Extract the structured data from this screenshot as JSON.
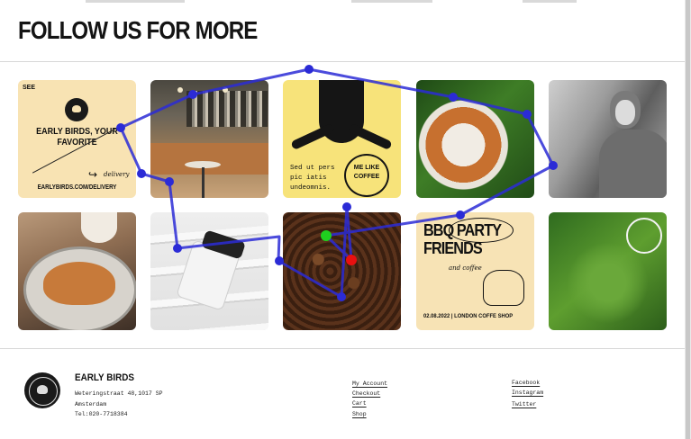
{
  "header": {
    "title": "FOLLOW US FOR MORE"
  },
  "gallery": {
    "tile1": {
      "see": "SEE",
      "headline": "EARLY BIRDS, YOUR FAVORITE",
      "delivery": "delivery",
      "url": "EARLYBIRDS.COM/DELIVERY"
    },
    "tile3": {
      "text": "Sed ut pers pic iatis undeomnis.",
      "badge": "ME LIKE COFFEE"
    },
    "tile9": {
      "headline": "BBQ PARTY FRIENDS",
      "subtitle": "and coffee",
      "date": "02.08.2022 | LONDON COFFE SHOP"
    }
  },
  "footer": {
    "brand": "EARLY BIRDS",
    "address_line1": "Weteringstraat 48,1017 SP",
    "address_line2": "Amsterdam",
    "phone": "Tel:020-7718384",
    "links_col1": [
      "My Account",
      "Checkout",
      "Cart",
      "Shop"
    ],
    "links_col2": [
      "Facebook",
      "Instagram",
      "Twitter"
    ]
  },
  "overlay": {
    "path_color": "#2b2bd6",
    "marker_green": "#1fd01f",
    "marker_red": "#e81010"
  }
}
